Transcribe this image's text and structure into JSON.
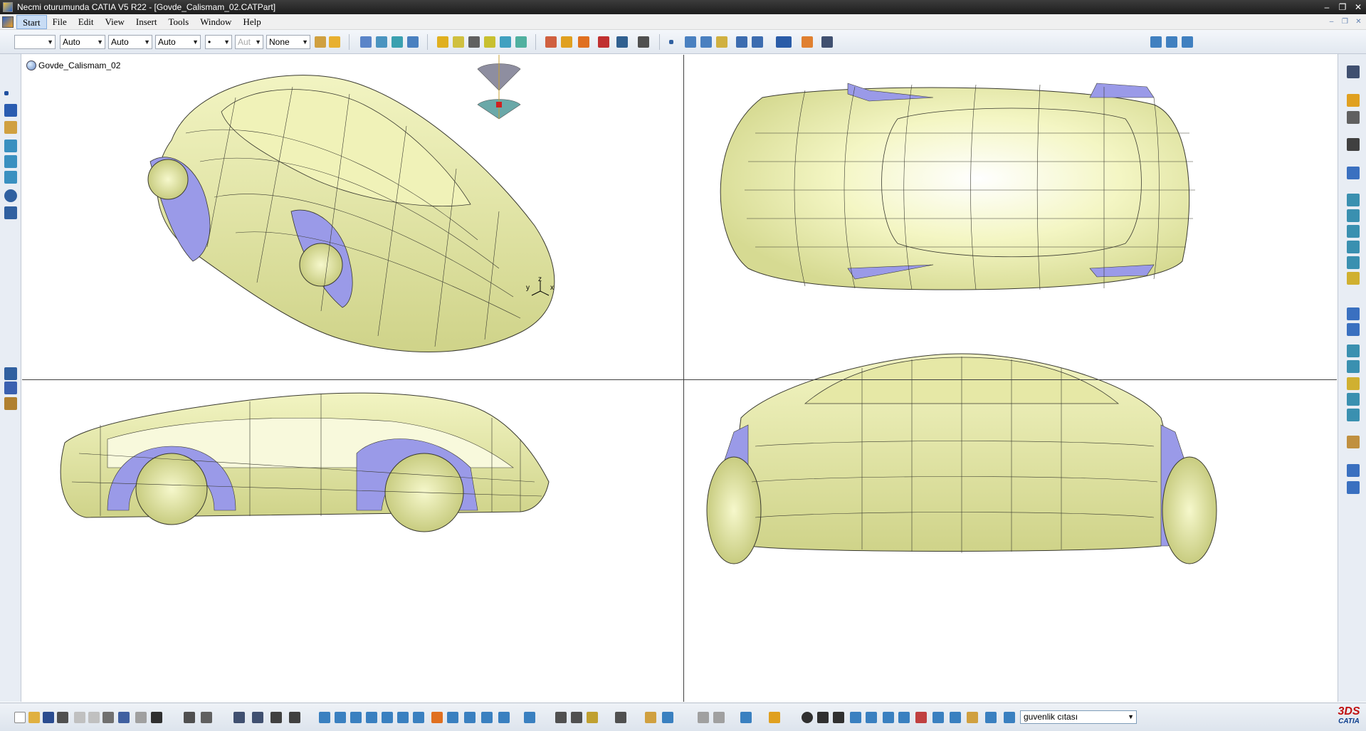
{
  "window": {
    "title": "Necmi oturumunda CATIA V5 R22 - [Govde_Calismam_02.CATPart]",
    "minimize_glyph": "–",
    "maximize_glyph": "❐",
    "close_glyph": "✕"
  },
  "menu": {
    "items": [
      "Start",
      "File",
      "Edit",
      "View",
      "Insert",
      "Tools",
      "Window",
      "Help"
    ],
    "active": "Start"
  },
  "toolbar_top": {
    "color_combo": "",
    "line_type_combo": "Auto",
    "line_weight_combo": "Auto",
    "layer_combo": "Auto",
    "point_combo": "•",
    "disabled_combo": "Aut",
    "rendering_combo": "None"
  },
  "tree": {
    "root_label": "Govde_Calismam_02"
  },
  "compass": {
    "x_label": "x",
    "y_label": "y",
    "z_label": "z"
  },
  "toolbar_bottom": {
    "search_value": "guvenlik cıtası"
  },
  "brand": {
    "logo_text": "CATIA",
    "logo_mark": "3DS"
  },
  "colors": {
    "body_surface": "#eef0b0",
    "body_shadow": "#d2d68a",
    "wheel_arch": "#9a9ae8",
    "wire_line": "#3a3a30",
    "viewport_divider": "#404040",
    "toolbar_bg": "#e8edf4"
  },
  "icons": {
    "app": "catia-app-icon",
    "start": "start-icon",
    "part": "part-body-icon",
    "compass": "compass-icon"
  }
}
